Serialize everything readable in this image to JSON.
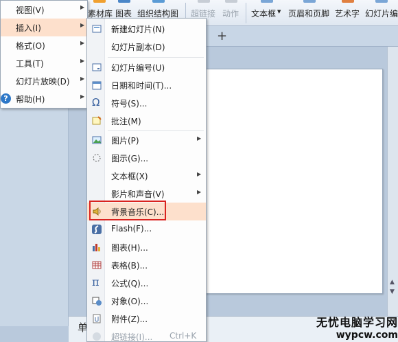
{
  "ribbon": {
    "items": [
      {
        "label": "素材库",
        "disabled": false
      },
      {
        "label": "图表",
        "disabled": false
      },
      {
        "label": "组织结构图",
        "disabled": false
      },
      {
        "label": "超链接",
        "disabled": true
      },
      {
        "label": "动作",
        "disabled": true
      },
      {
        "label": "文本框",
        "disabled": false
      },
      {
        "label": "页眉和页脚",
        "disabled": false
      },
      {
        "label": "艺术字",
        "disabled": false
      },
      {
        "label": "幻灯片编",
        "disabled": false
      }
    ]
  },
  "tabs": {
    "add_label": "+"
  },
  "notes": {
    "label": "单"
  },
  "menu": {
    "items": [
      {
        "label": "视图(V)"
      },
      {
        "label": "插入(I)"
      },
      {
        "label": "格式(O)"
      },
      {
        "label": "工具(T)"
      },
      {
        "label": "幻灯片放映(D)"
      },
      {
        "label": "帮助(H)"
      }
    ]
  },
  "submenu": {
    "items": [
      {
        "label": "新建幻灯片(N)",
        "icon": "new-slide-icon"
      },
      {
        "label": "幻灯片副本(D)",
        "icon": ""
      },
      {
        "label": "幻灯片编号(U)",
        "icon": "slide-number-icon"
      },
      {
        "label": "日期和时间(T)...",
        "icon": "calendar-icon"
      },
      {
        "label": "符号(S)...",
        "icon": "omega-icon"
      },
      {
        "label": "批注(M)",
        "icon": "comment-icon"
      },
      {
        "label": "图片(P)",
        "icon": "picture-icon"
      },
      {
        "label": "图示(G)...",
        "icon": "diagram-icon"
      },
      {
        "label": "文本框(X)",
        "icon": ""
      },
      {
        "label": "影片和声音(V)",
        "icon": ""
      },
      {
        "label": "背景音乐(C)...",
        "icon": "speaker-icon"
      },
      {
        "label": "Flash(F)...",
        "icon": "flash-icon"
      },
      {
        "label": "图表(H)...",
        "icon": "chart-icon"
      },
      {
        "label": "表格(B)...",
        "icon": "table-icon"
      },
      {
        "label": "公式(Q)...",
        "icon": "pi-icon"
      },
      {
        "label": "对象(O)...",
        "icon": "object-icon"
      },
      {
        "label": "附件(Z)...",
        "icon": "attachment-icon"
      },
      {
        "label": "超链接(I)...",
        "icon": "hyperlink-icon",
        "shortcut": "Ctrl+K"
      }
    ]
  },
  "help_icon_glyph": "?",
  "colors": {
    "highlight": "#fde0cc",
    "callout": "#d9231f"
  },
  "watermark": {
    "line1": "无忧电脑学习网",
    "line2": "wypcw.com"
  }
}
